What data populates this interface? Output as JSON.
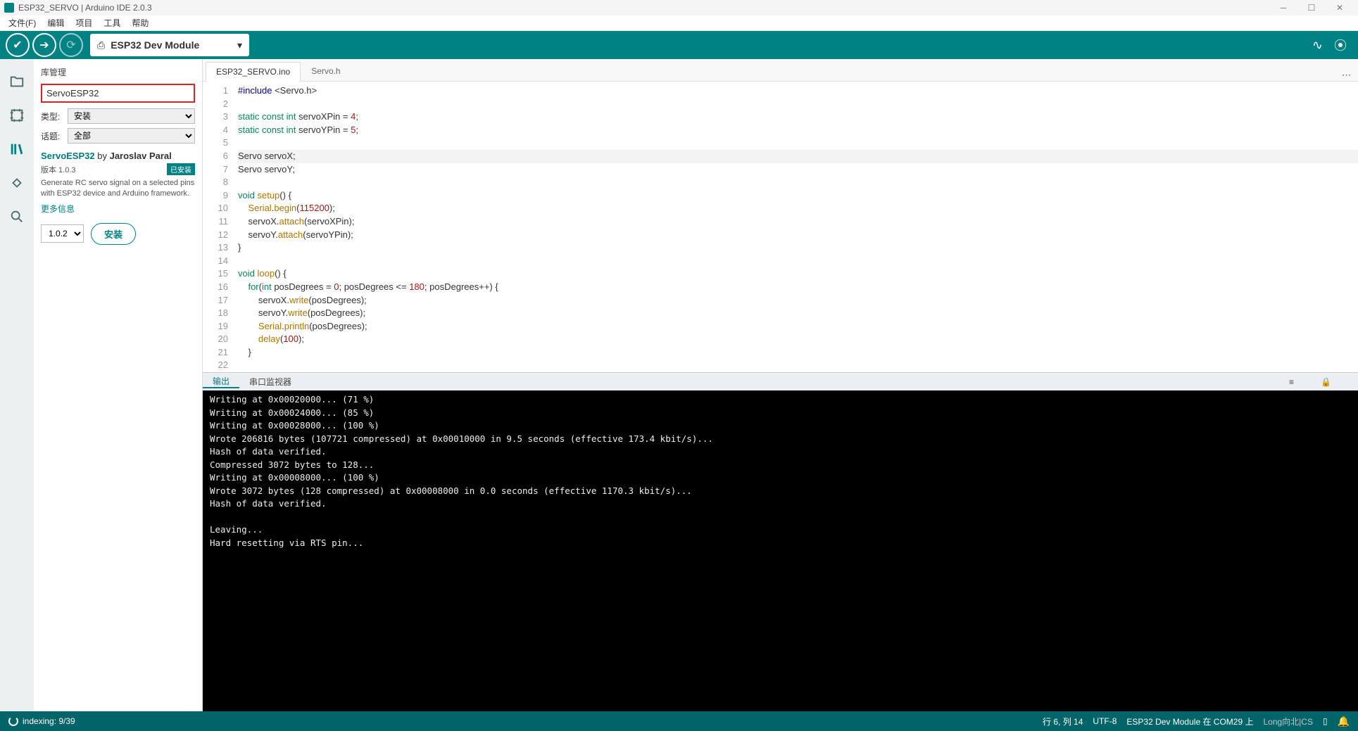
{
  "titlebar": {
    "title": "ESP32_SERVO | Arduino IDE 2.0.3"
  },
  "menu": {
    "file": "文件(F)",
    "edit": "编辑",
    "project": "项目",
    "tools": "工具",
    "help": "帮助"
  },
  "toolbar": {
    "board": "ESP32 Dev Module"
  },
  "sidepanel": {
    "title": "库管理",
    "search_value": "ServoESP32",
    "type_label": "类型:",
    "type_value": "安装",
    "topic_label": "话题:",
    "topic_value": "全部",
    "lib": {
      "name": "ServoESP32",
      "by": "by",
      "author": "Jaroslav Paral",
      "version": "版本 1.0.3",
      "installed_badge": "已安装",
      "desc": "Generate RC servo signal on a selected pins with ESP32 device and Arduino framework.",
      "more": "更多信息",
      "version_select": "1.0.2",
      "install_btn": "安装"
    }
  },
  "tabs": {
    "t1": "ESP32_SERVO.ino",
    "t2": "Servo.h"
  },
  "code_lines": [
    {
      "n": 1,
      "html": "<span class='kw2'>#include</span> <span>&lt;Servo.h&gt;</span>"
    },
    {
      "n": 2,
      "html": ""
    },
    {
      "n": 3,
      "html": "<span class='kw'>static</span> <span class='kw'>const</span> <span class='kw'>int</span> servoXPin = <span class='num'>4</span>;"
    },
    {
      "n": 4,
      "html": "<span class='kw'>static</span> <span class='kw'>const</span> <span class='kw'>int</span> servoYPin = <span class='num'>5</span>;"
    },
    {
      "n": 5,
      "html": ""
    },
    {
      "n": 6,
      "html": "Servo servoX;",
      "hl": true
    },
    {
      "n": 7,
      "html": "Servo servoY;"
    },
    {
      "n": 8,
      "html": ""
    },
    {
      "n": 9,
      "html": "<span class='kw'>void</span> <span class='fn'>setup</span>() {"
    },
    {
      "n": 10,
      "html": "    <span class='fn'>Serial</span>.<span class='fn'>begin</span>(<span class='num'>115200</span>);"
    },
    {
      "n": 11,
      "html": "    servoX.<span class='fn'>attach</span>(servoXPin);"
    },
    {
      "n": 12,
      "html": "    servoY.<span class='fn'>attach</span>(servoYPin);"
    },
    {
      "n": 13,
      "html": "}"
    },
    {
      "n": 14,
      "html": ""
    },
    {
      "n": 15,
      "html": "<span class='kw'>void</span> <span class='fn'>loop</span>() {"
    },
    {
      "n": 16,
      "html": "    <span class='kw'>for</span>(<span class='kw'>int</span> posDegrees = <span class='num'>0</span>; posDegrees &lt;= <span class='num'>180</span>; posDegrees++) {"
    },
    {
      "n": 17,
      "html": "        servoX.<span class='fn'>write</span>(posDegrees);"
    },
    {
      "n": 18,
      "html": "        servoY.<span class='fn'>write</span>(posDegrees);"
    },
    {
      "n": 19,
      "html": "        <span class='fn'>Serial</span>.<span class='fn'>println</span>(posDegrees);"
    },
    {
      "n": 20,
      "html": "        <span class='fn'>delay</span>(<span class='num'>100</span>);"
    },
    {
      "n": 21,
      "html": "    }"
    },
    {
      "n": 22,
      "html": ""
    }
  ],
  "outtabs": {
    "output": "输出",
    "monitor": "串口监视器"
  },
  "console_lines": [
    "Writing at 0x00020000... (71 %)",
    "Writing at 0x00024000... (85 %)",
    "Writing at 0x00028000... (100 %)",
    "Wrote 206816 bytes (107721 compressed) at 0x00010000 in 9.5 seconds (effective 173.4 kbit/s)...",
    "Hash of data verified.",
    "Compressed 3072 bytes to 128...",
    "Writing at 0x00008000... (100 %)",
    "Wrote 3072 bytes (128 compressed) at 0x00008000 in 0.0 seconds (effective 1170.3 kbit/s)...",
    "Hash of data verified.",
    "",
    "Leaving...",
    "Hard resetting via RTS pin..."
  ],
  "status": {
    "indexing": "indexing: 9/39",
    "cursor": "行 6,  列 14",
    "encoding": "UTF-8",
    "board": "ESP32 Dev Module 在 COM29 上",
    "watermark": "Long向北|CS"
  }
}
